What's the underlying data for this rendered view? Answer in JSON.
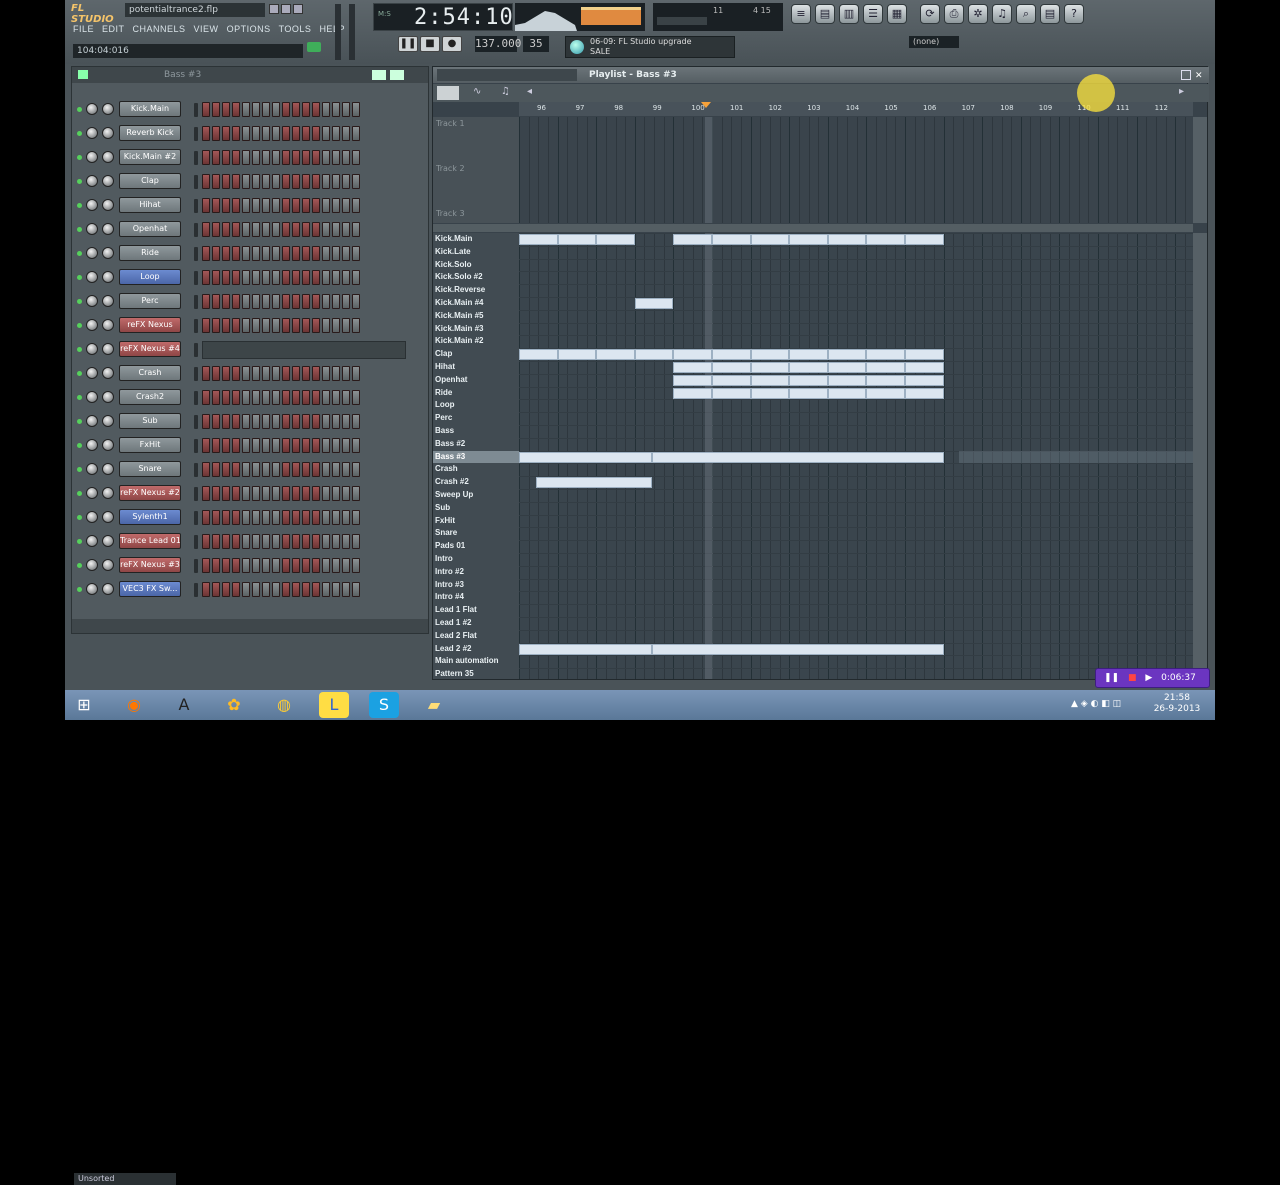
{
  "topbar": {
    "logo": "FL STUDIO",
    "filename": "potentialtrance2.flp",
    "menu": [
      "FILE",
      "EDIT",
      "CHANNELS",
      "VIEW",
      "OPTIONS",
      "TOOLS",
      "HELP"
    ],
    "hint": "104:04:016",
    "clock": "2:54:10",
    "tempo": "137.000",
    "pattern": "35",
    "news_line1": "06-09: FL Studio upgrade",
    "news_line2": "SALE",
    "monitor": "(none)",
    "cpu": "11",
    "poly": "4  15"
  },
  "rack": {
    "title": "Bass #3",
    "footer": "Unsorted",
    "channels": [
      {
        "name": "Kick.Main",
        "style": "norm"
      },
      {
        "name": "Reverb Kick",
        "style": "norm"
      },
      {
        "name": "Kick.Main #2",
        "style": "norm"
      },
      {
        "name": "Clap",
        "style": "norm"
      },
      {
        "name": "Hihat",
        "style": "norm"
      },
      {
        "name": "Openhat",
        "style": "norm"
      },
      {
        "name": "Ride",
        "style": "norm"
      },
      {
        "name": "Loop",
        "style": "blue"
      },
      {
        "name": "Perc",
        "style": "norm"
      },
      {
        "name": "reFX Nexus",
        "style": "red"
      },
      {
        "name": "reFX Nexus #4",
        "style": "red"
      },
      {
        "name": "Crash",
        "style": "norm"
      },
      {
        "name": "Crash2",
        "style": "norm"
      },
      {
        "name": "Sub",
        "style": "norm"
      },
      {
        "name": "FxHit",
        "style": "norm"
      },
      {
        "name": "Snare",
        "style": "norm"
      },
      {
        "name": "reFX Nexus #2",
        "style": "red"
      },
      {
        "name": "Sylenth1",
        "style": "blue"
      },
      {
        "name": "Trance Lead 01",
        "style": "red"
      },
      {
        "name": "reFX Nexus #3",
        "style": "red"
      },
      {
        "name": "VEC3 FX Sw...",
        "style": "blue"
      }
    ]
  },
  "playlist": {
    "title": "Playlist - Bass #3",
    "bars": [
      "96",
      "97",
      "98",
      "99",
      "100",
      "101",
      "102",
      "103",
      "104",
      "105",
      "106",
      "107",
      "108",
      "109",
      "110",
      "111",
      "112"
    ],
    "tracks": [
      "Track 1",
      "Track 2",
      "Track 3"
    ],
    "patterns": [
      "Kick.Main",
      "Kick.Late",
      "Kick.Solo",
      "Kick.Solo #2",
      "Kick.Reverse",
      "Kick.Main #4",
      "Kick.Main #5",
      "Kick.Main #3",
      "Kick.Main #2",
      "Clap",
      "Hihat",
      "Openhat",
      "Ride",
      "Loop",
      "Perc",
      "Bass",
      "Bass #2",
      "Bass #3",
      "Crash",
      "Crash #2",
      "Sweep Up",
      "Sub",
      "FxHit",
      "Snare",
      "Pads 01",
      "Intro",
      "Intro #2",
      "Intro #3",
      "Intro #4",
      "Lead 1 Flat",
      "Lead 1 #2",
      "Lead 2 Flat",
      "Lead 2 #2",
      "Main automation",
      "Pattern 35"
    ],
    "selected_pattern": "Bass #3"
  },
  "taskbar": {
    "time": "21:58",
    "date": "26-9-2013",
    "recorder_time": "0:06:37"
  }
}
